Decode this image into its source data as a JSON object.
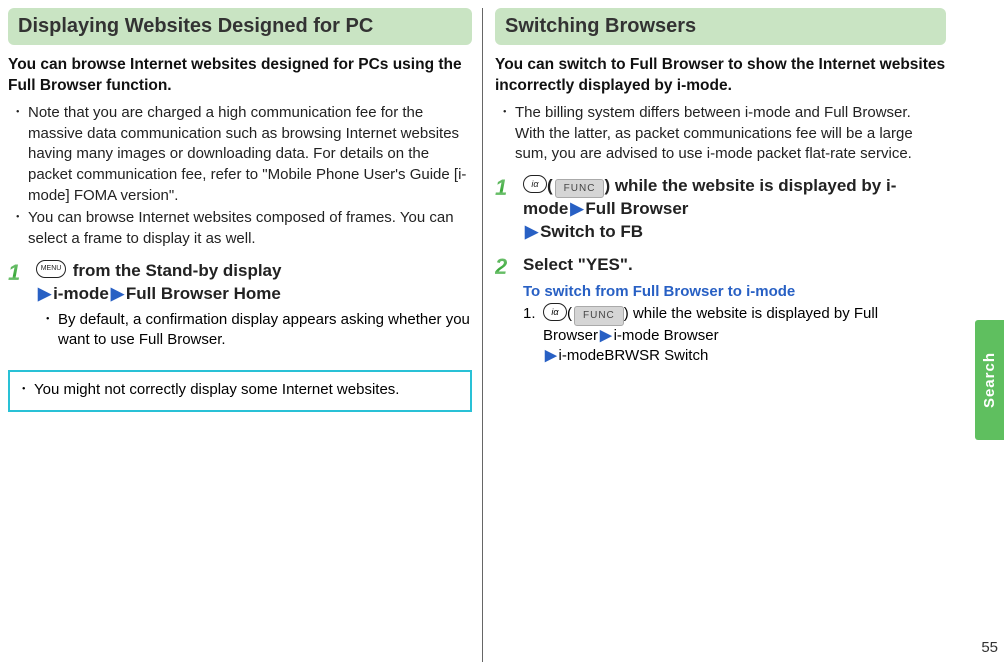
{
  "side_tab": "Search",
  "page_number": "55",
  "left": {
    "title": "Displaying Websites Designed for PC",
    "intro": "You can browse Internet websites designed for PCs using the Full Browser function.",
    "bullets": [
      "Note that you are charged a high communication fee for the massive data communication such as browsing Internet websites having many images or downloading data. For details on the packet communication fee, refer to \"Mobile Phone User's Guide [i-mode] FOMA version\".",
      "You can browse Internet websites composed of frames. You can select a frame to display it as well."
    ],
    "step1": {
      "num": "1",
      "menu_label": "MENU",
      "line1_a": " from the Stand-by display",
      "line2_a": "i-mode",
      "line2_b": "Full Browser Home",
      "sub_bullet": "By default, a confirmation display appears asking whether you want to use Full Browser."
    },
    "note": "You might not correctly display some Internet websites."
  },
  "right": {
    "title": "Switching Browsers",
    "intro": "You can switch to Full Browser to show the Internet websites incorrectly displayed by i-mode.",
    "bullets": [
      "The billing system differs between i-mode and Full Browser. With the latter, as packet communications fee will be a large sum, you are advised to use i-mode packet flat-rate service."
    ],
    "step1": {
      "num": "1",
      "func_circle": "iα",
      "func_box": "FUNC",
      "line1_b": ") while the website is displayed by i-mode",
      "line1_c": "Full Browser",
      "line2_a": "Switch to FB"
    },
    "step2": {
      "num": "2",
      "line1": "Select \"YES\".",
      "sub_heading": "To switch from Full Browser to i-mode",
      "sub_num": "1.",
      "func_circle": "iα",
      "func_box": "FUNC",
      "sub_line_a": ") while the website is displayed by Full Browser",
      "sub_line_b": "i-mode Browser",
      "sub_line_c": "i-modeBRWSR Switch"
    }
  }
}
